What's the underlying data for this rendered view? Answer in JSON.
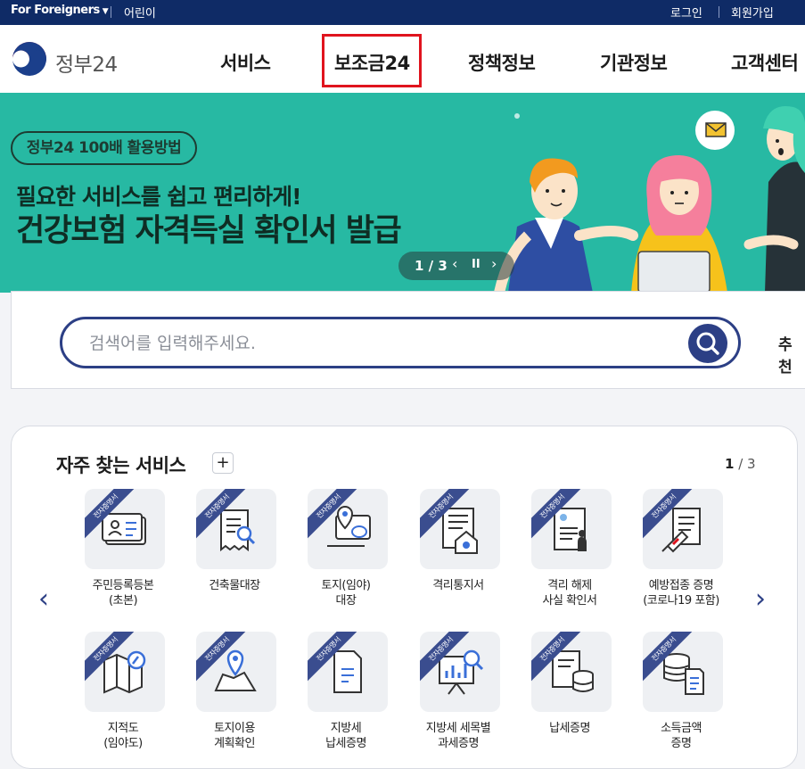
{
  "util_bar": {
    "language": "For Foreigners",
    "kids": "어린이",
    "login": "로그인",
    "signup": "회원가입"
  },
  "header": {
    "logo_text": "정부24",
    "nav": [
      "서비스",
      "보조금24",
      "정책정보",
      "기관정보",
      "고객센터"
    ]
  },
  "banner": {
    "pill": "정부24 100배 활용방법",
    "subtitle": "필요한 서비스를 쉽고 편리하게!",
    "title": "건강보험 자격득실 확인서 발급",
    "pager": "1 / 3"
  },
  "search": {
    "placeholder": "검색어를 입력해주세요.",
    "recommend": "추천"
  },
  "services": {
    "title": "자주 찾는 서비스",
    "plus": "+",
    "page_current": "1",
    "page_total": "/ 3",
    "ribbon": "전자증명서",
    "items": [
      {
        "label": "주민등록등본\n(초본)",
        "icon": "id-card-icon"
      },
      {
        "label": "건축물대장",
        "icon": "building-register-icon"
      },
      {
        "label": "토지(임야)\n대장",
        "icon": "land-map-icon"
      },
      {
        "label": "격리통지서",
        "icon": "quarantine-notice-icon"
      },
      {
        "label": "격리 해제\n사실 확인서",
        "icon": "quarantine-release-icon"
      },
      {
        "label": "예방접종 증명\n(코로나19 포함)",
        "icon": "vaccination-icon"
      },
      {
        "label": "지적도\n(임야도)",
        "icon": "cadastral-map-icon"
      },
      {
        "label": "토지이용\n계획확인",
        "icon": "land-use-icon"
      },
      {
        "label": "지방세\n납세증명",
        "icon": "local-tax-icon"
      },
      {
        "label": "지방세 세목별\n과세증명",
        "icon": "tax-chart-icon"
      },
      {
        "label": "납세증명",
        "icon": "tax-payment-icon"
      },
      {
        "label": "소득금액\n증명",
        "icon": "income-icon"
      }
    ]
  },
  "colors": {
    "navy": "#0f2b66",
    "accent": "#2c3f85",
    "banner": "#27b9a3",
    "highlight": "#e0141e"
  }
}
